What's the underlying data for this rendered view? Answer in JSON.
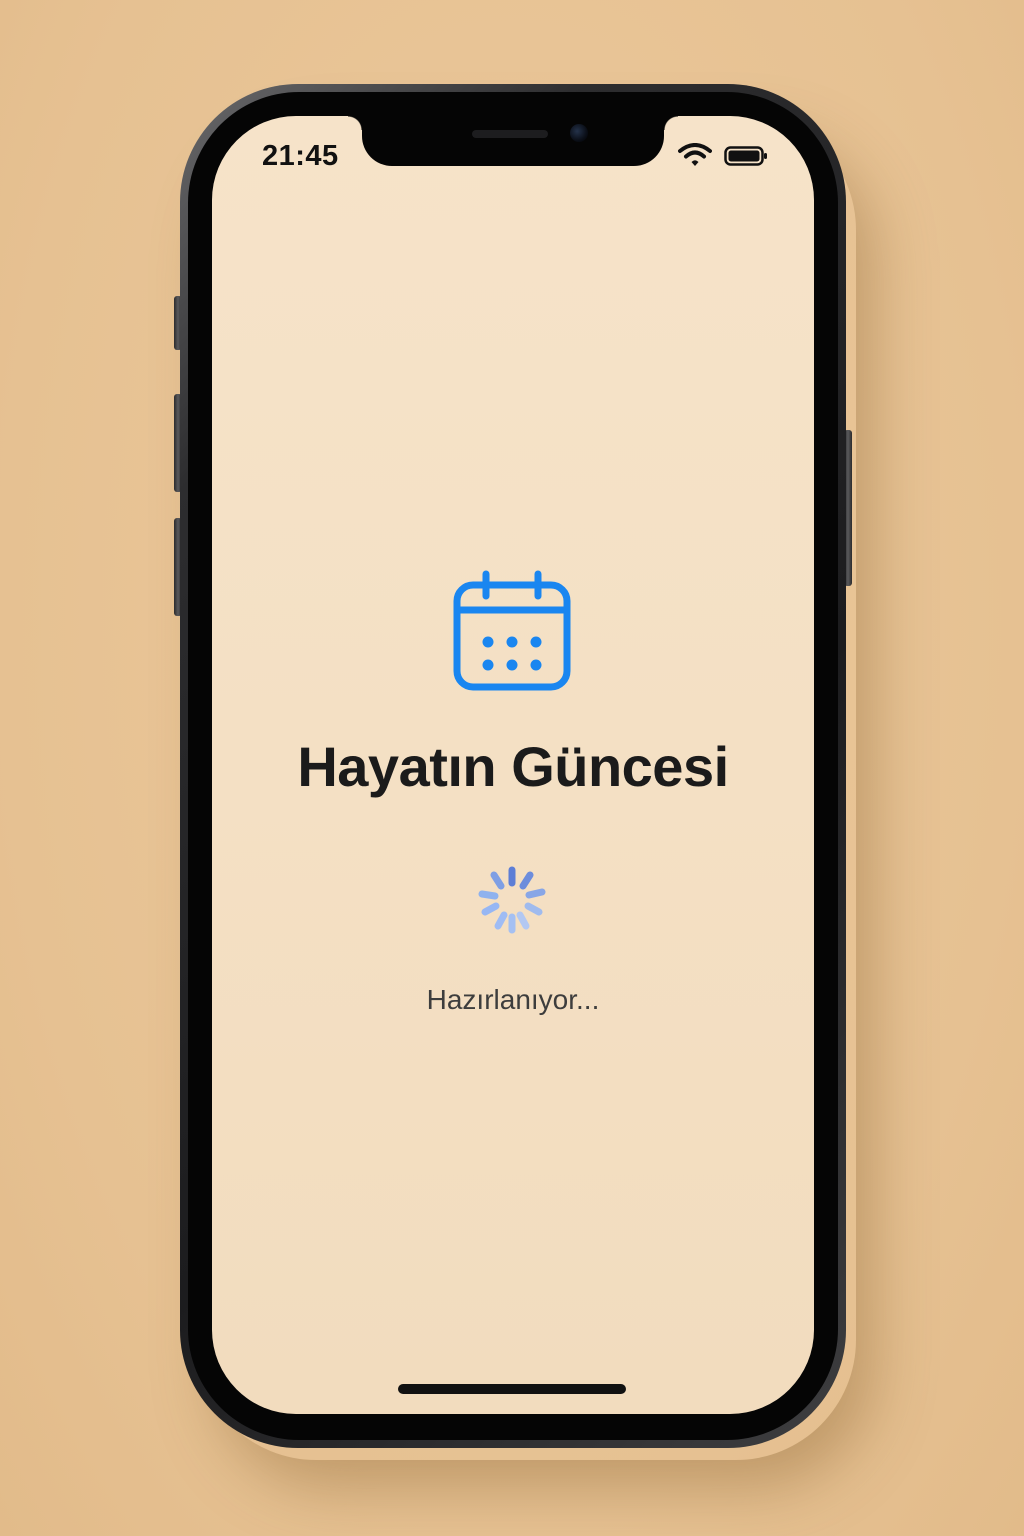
{
  "status_bar": {
    "time": "21:45",
    "wifi_icon": "wifi-icon",
    "battery_icon": "battery-icon"
  },
  "splash": {
    "app_icon": "calendar-icon",
    "title": "Hayatın Güncesi",
    "spinner_icon": "loading-spinner-icon",
    "loading_text": "Hazırlanıyor..."
  },
  "colors": {
    "accent": "#1a86f0",
    "spinner": "#8fb2ee",
    "screen_background": "#f6e3c9",
    "backdrop": "#e9c596",
    "title_text": "#1b1b1b"
  }
}
